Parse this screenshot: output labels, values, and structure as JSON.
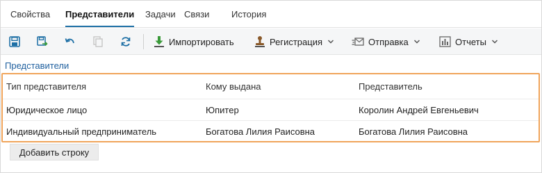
{
  "tabs": [
    {
      "label": "Свойства",
      "active": false
    },
    {
      "label": "Представители",
      "active": true
    },
    {
      "label": "Задачи",
      "active": false
    },
    {
      "label": "Связи",
      "active": false
    },
    {
      "label": "История",
      "active": false
    }
  ],
  "toolbar": {
    "icons": [
      "save-icon",
      "save-and-close-icon",
      "undo-icon",
      "copy-icon",
      "refresh-icon"
    ],
    "import_label": "Импортировать",
    "registration_label": "Регистрация",
    "sending_label": "Отправка",
    "reports_label": "Отчеты"
  },
  "section": {
    "title": "Представители"
  },
  "table": {
    "columns": [
      "Тип представителя",
      "Кому выдана",
      "Представитель"
    ],
    "rows": [
      [
        "Юридическое лицо",
        "Юпитер",
        "Королин Андрей Евгеньевич"
      ],
      [
        "Индивидуальный предприниматель",
        "Богатова Лилия Раисовна",
        "Богатова Лилия Раисовна"
      ]
    ]
  },
  "add_row_label": "Добавить строку",
  "colors": {
    "accent": "#1d6fa5",
    "highlight_border": "#f0a45a",
    "link": "#1e5f9e"
  }
}
